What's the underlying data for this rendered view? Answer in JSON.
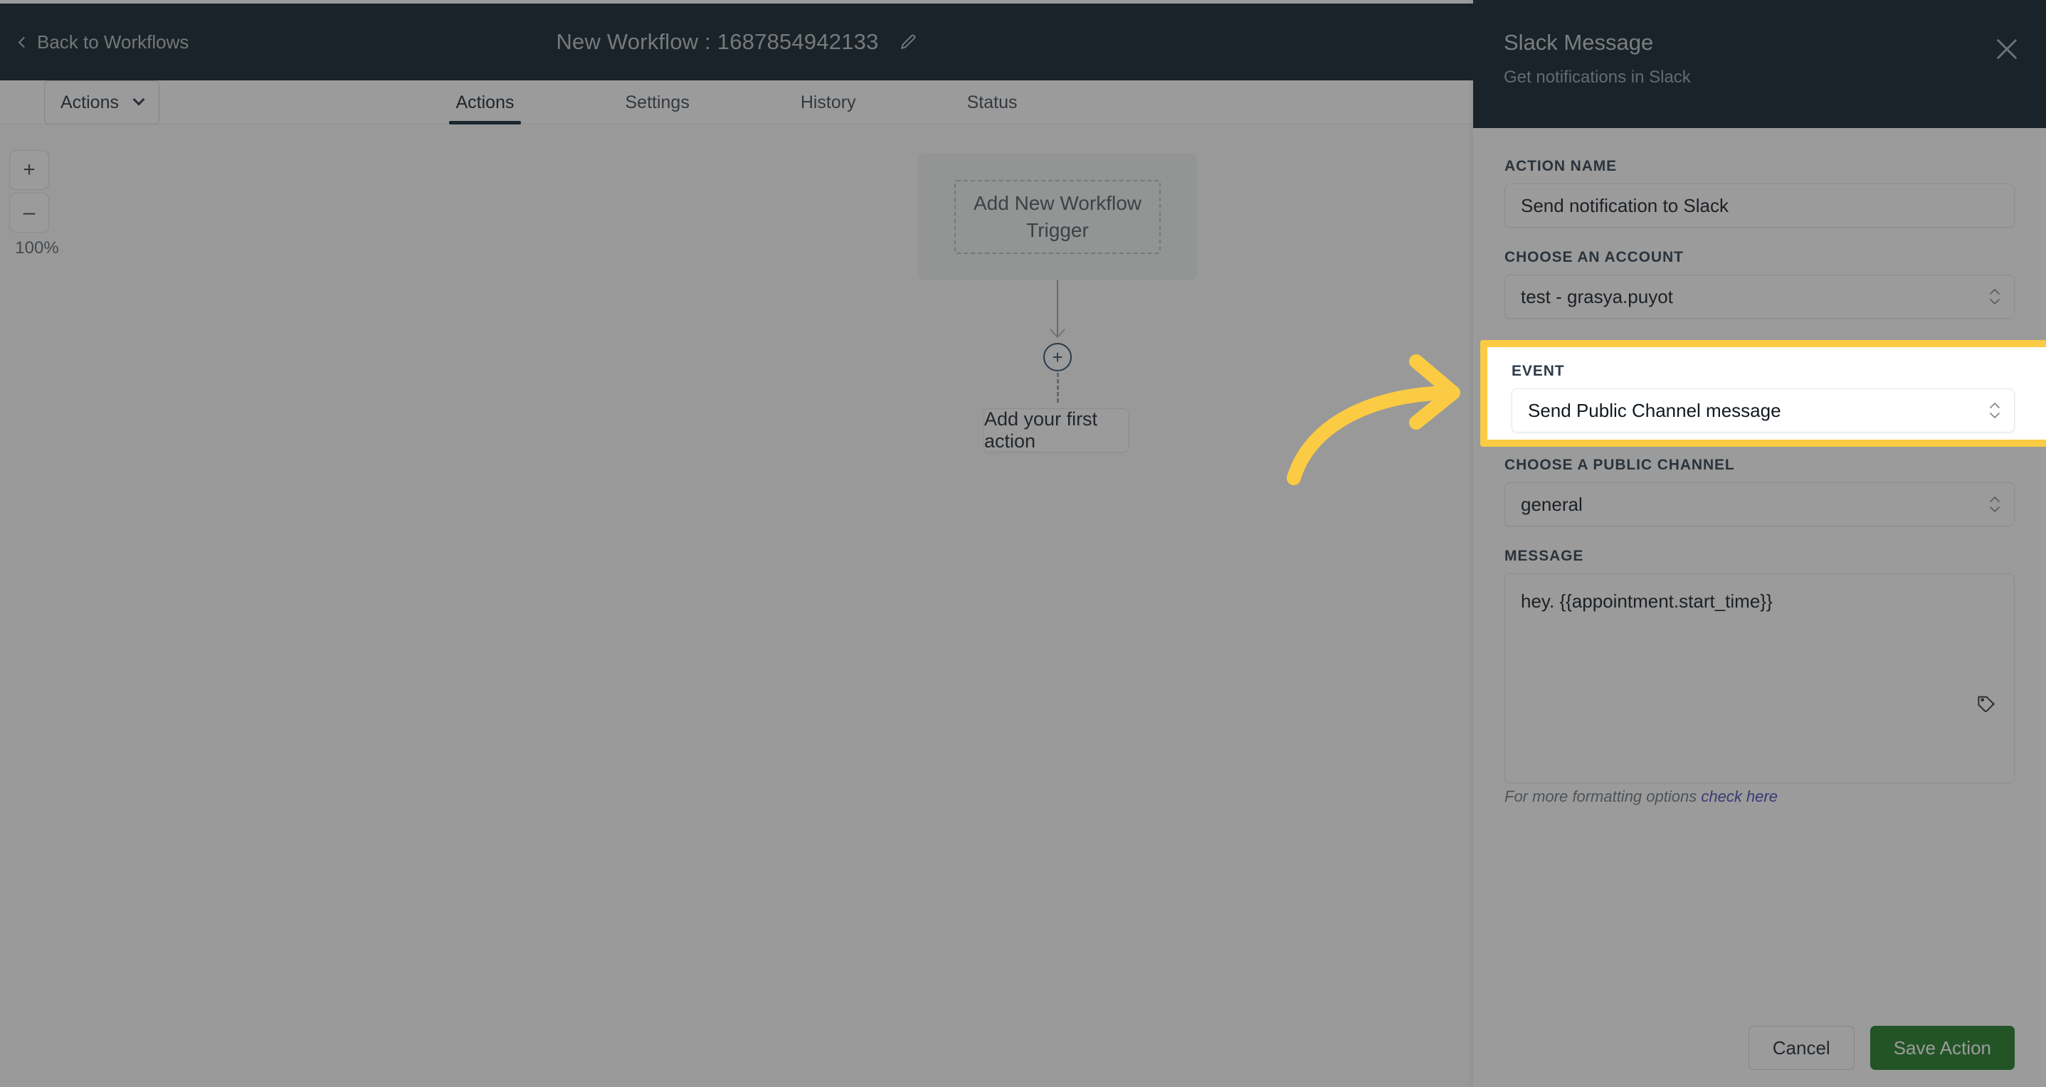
{
  "header": {
    "back_label": "Back to Workflows",
    "back_icon": "chevron-left-icon",
    "workflow_title": "New Workflow : 1687854942133",
    "edit_icon": "pencil-icon"
  },
  "toolbar": {
    "actions_label": "Actions",
    "actions_chevron": "chevron-down-icon"
  },
  "tabs": [
    {
      "label": "Actions",
      "active": true
    },
    {
      "label": "Settings",
      "active": false
    },
    {
      "label": "History",
      "active": false
    },
    {
      "label": "Status",
      "active": false
    }
  ],
  "canvas": {
    "zoom_in": "+",
    "zoom_out": "–",
    "zoom_level": "100%",
    "trigger_placeholder": "Add New Workflow Trigger",
    "add_node_icon": "plus-circle-icon",
    "first_action_label": "Add your first action"
  },
  "panel": {
    "title": "Slack Message",
    "subtitle": "Get notifications in Slack",
    "close_icon": "close-icon",
    "fields": {
      "action_name": {
        "label": "ACTION NAME",
        "value": "Send notification to Slack"
      },
      "account": {
        "label": "CHOOSE AN ACCOUNT",
        "value": "test - grasya.puyot",
        "stepper_icon": "stepper-updown-icon"
      },
      "event": {
        "label": "EVENT",
        "value": "Send Public Channel message",
        "stepper_icon": "stepper-updown-icon",
        "highlighted": true
      },
      "channel": {
        "label": "CHOOSE A PUBLIC CHANNEL",
        "value": "general",
        "stepper_icon": "stepper-updown-icon"
      },
      "message": {
        "label": "MESSAGE",
        "value": "hey. {{appointment.start_time}}",
        "tag_icon": "tag-icon",
        "helper_prefix": "For more formatting options ",
        "helper_link": "check here"
      }
    },
    "footer": {
      "cancel_label": "Cancel",
      "save_label": "Save Action"
    }
  },
  "annotation": {
    "arrow_icon": "curved-arrow-right-icon",
    "highlight_color": "#fbcb43",
    "arrow_color": "#fbcb43"
  },
  "colors": {
    "topbar_bg": "#0b1e28",
    "accent_green": "#1b7a22",
    "link_purple": "#4a42b8",
    "node_blue": "#2b4b66"
  }
}
